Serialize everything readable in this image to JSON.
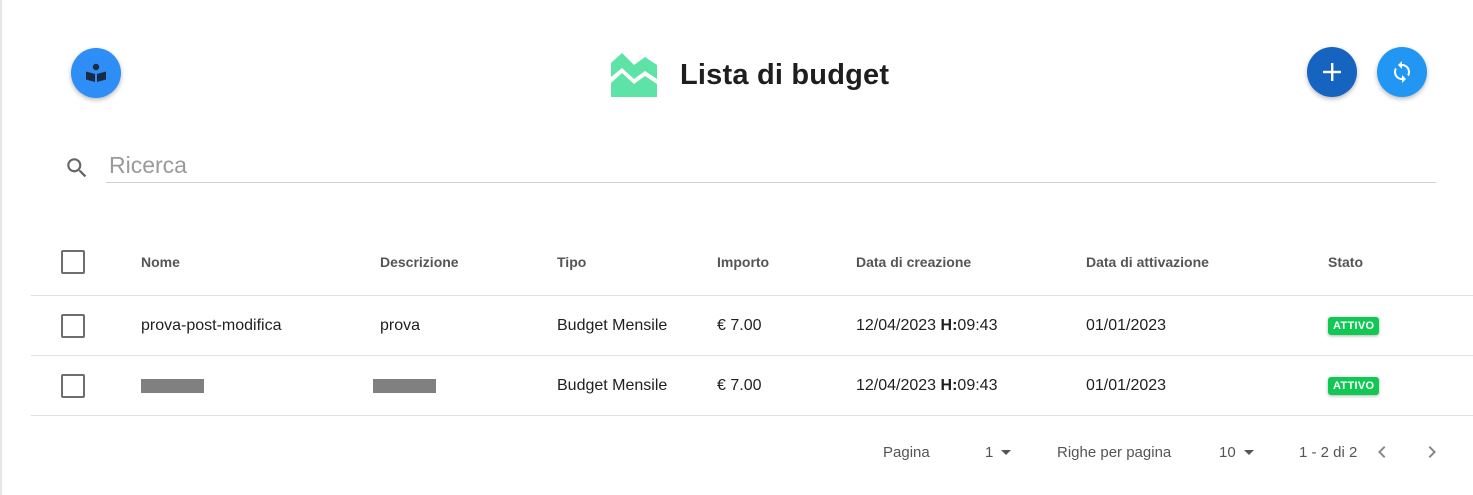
{
  "header": {
    "title": "Lista di budget",
    "icons": {
      "help": "book-reader-icon",
      "logo": "chart-logo-icon",
      "add": "plus-icon",
      "refresh": "sync-icon"
    }
  },
  "search": {
    "placeholder": "Ricerca",
    "value": ""
  },
  "table": {
    "columns": [
      "Nome",
      "Descrizione",
      "Tipo",
      "Importo",
      "Data di creazione",
      "Data di attivazione",
      "Stato"
    ],
    "rows": [
      {
        "nome": "prova-post-modifica",
        "descrizione": "prova",
        "tipo": "Budget Mensile",
        "importo": "€ 7.00",
        "data_creazione": "12/04/2023",
        "ora_label": "H:",
        "ora": "09:43",
        "data_attivazione": "01/01/2023",
        "stato": "ATTIVO"
      },
      {
        "nome": "",
        "descrizione": "",
        "tipo": "Budget Mensile",
        "importo": "€ 7.00",
        "data_creazione": "12/04/2023",
        "ora_label": "H:",
        "ora": "09:43",
        "data_attivazione": "01/01/2023",
        "stato": "ATTIVO"
      }
    ]
  },
  "pagination": {
    "page_label": "Pagina",
    "page": "1",
    "rows_label": "Righe per pagina",
    "rows_per_page": "10",
    "range": "1 - 2 di 2"
  },
  "colors": {
    "primary": "#2196f3",
    "primary_dark": "#1565c0",
    "status_active": "#12c855",
    "logo": "#5de3a5"
  }
}
